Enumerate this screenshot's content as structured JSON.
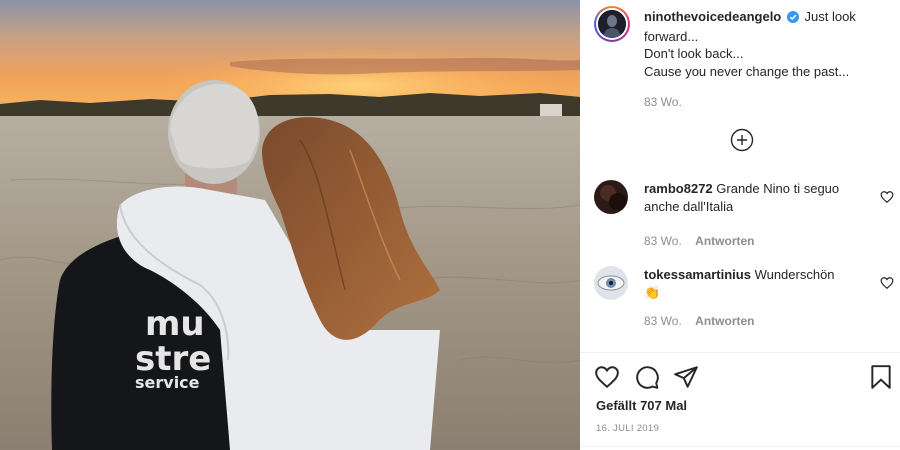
{
  "post": {
    "username": "ninothevoicedeangelo",
    "verified_icon": "verified-badge-icon",
    "caption": "Just look forward...\nDon't look back...\nCause you never change the past...",
    "time": "83 Wo.",
    "photo_shirt_text": [
      "mu",
      "stre",
      "service"
    ]
  },
  "comments": [
    {
      "username": "rambo8272",
      "text": "Grande Nino ti seguo anche dall'Italia",
      "time": "83 Wo.",
      "reply": "Antworten"
    },
    {
      "username": "tokessamartinius",
      "text": "Wunderschön",
      "emoji": "👏",
      "time": "83 Wo.",
      "reply": "Antworten"
    }
  ],
  "actions": {
    "likes": "Gefällt 707 Mal",
    "date": "16. JULI 2019",
    "icons": [
      "heart-icon",
      "comment-icon",
      "share-icon",
      "bookmark-icon"
    ]
  },
  "colors": {
    "verified": "#3897f0",
    "text": "#262626",
    "muted": "#8e8e8e"
  }
}
